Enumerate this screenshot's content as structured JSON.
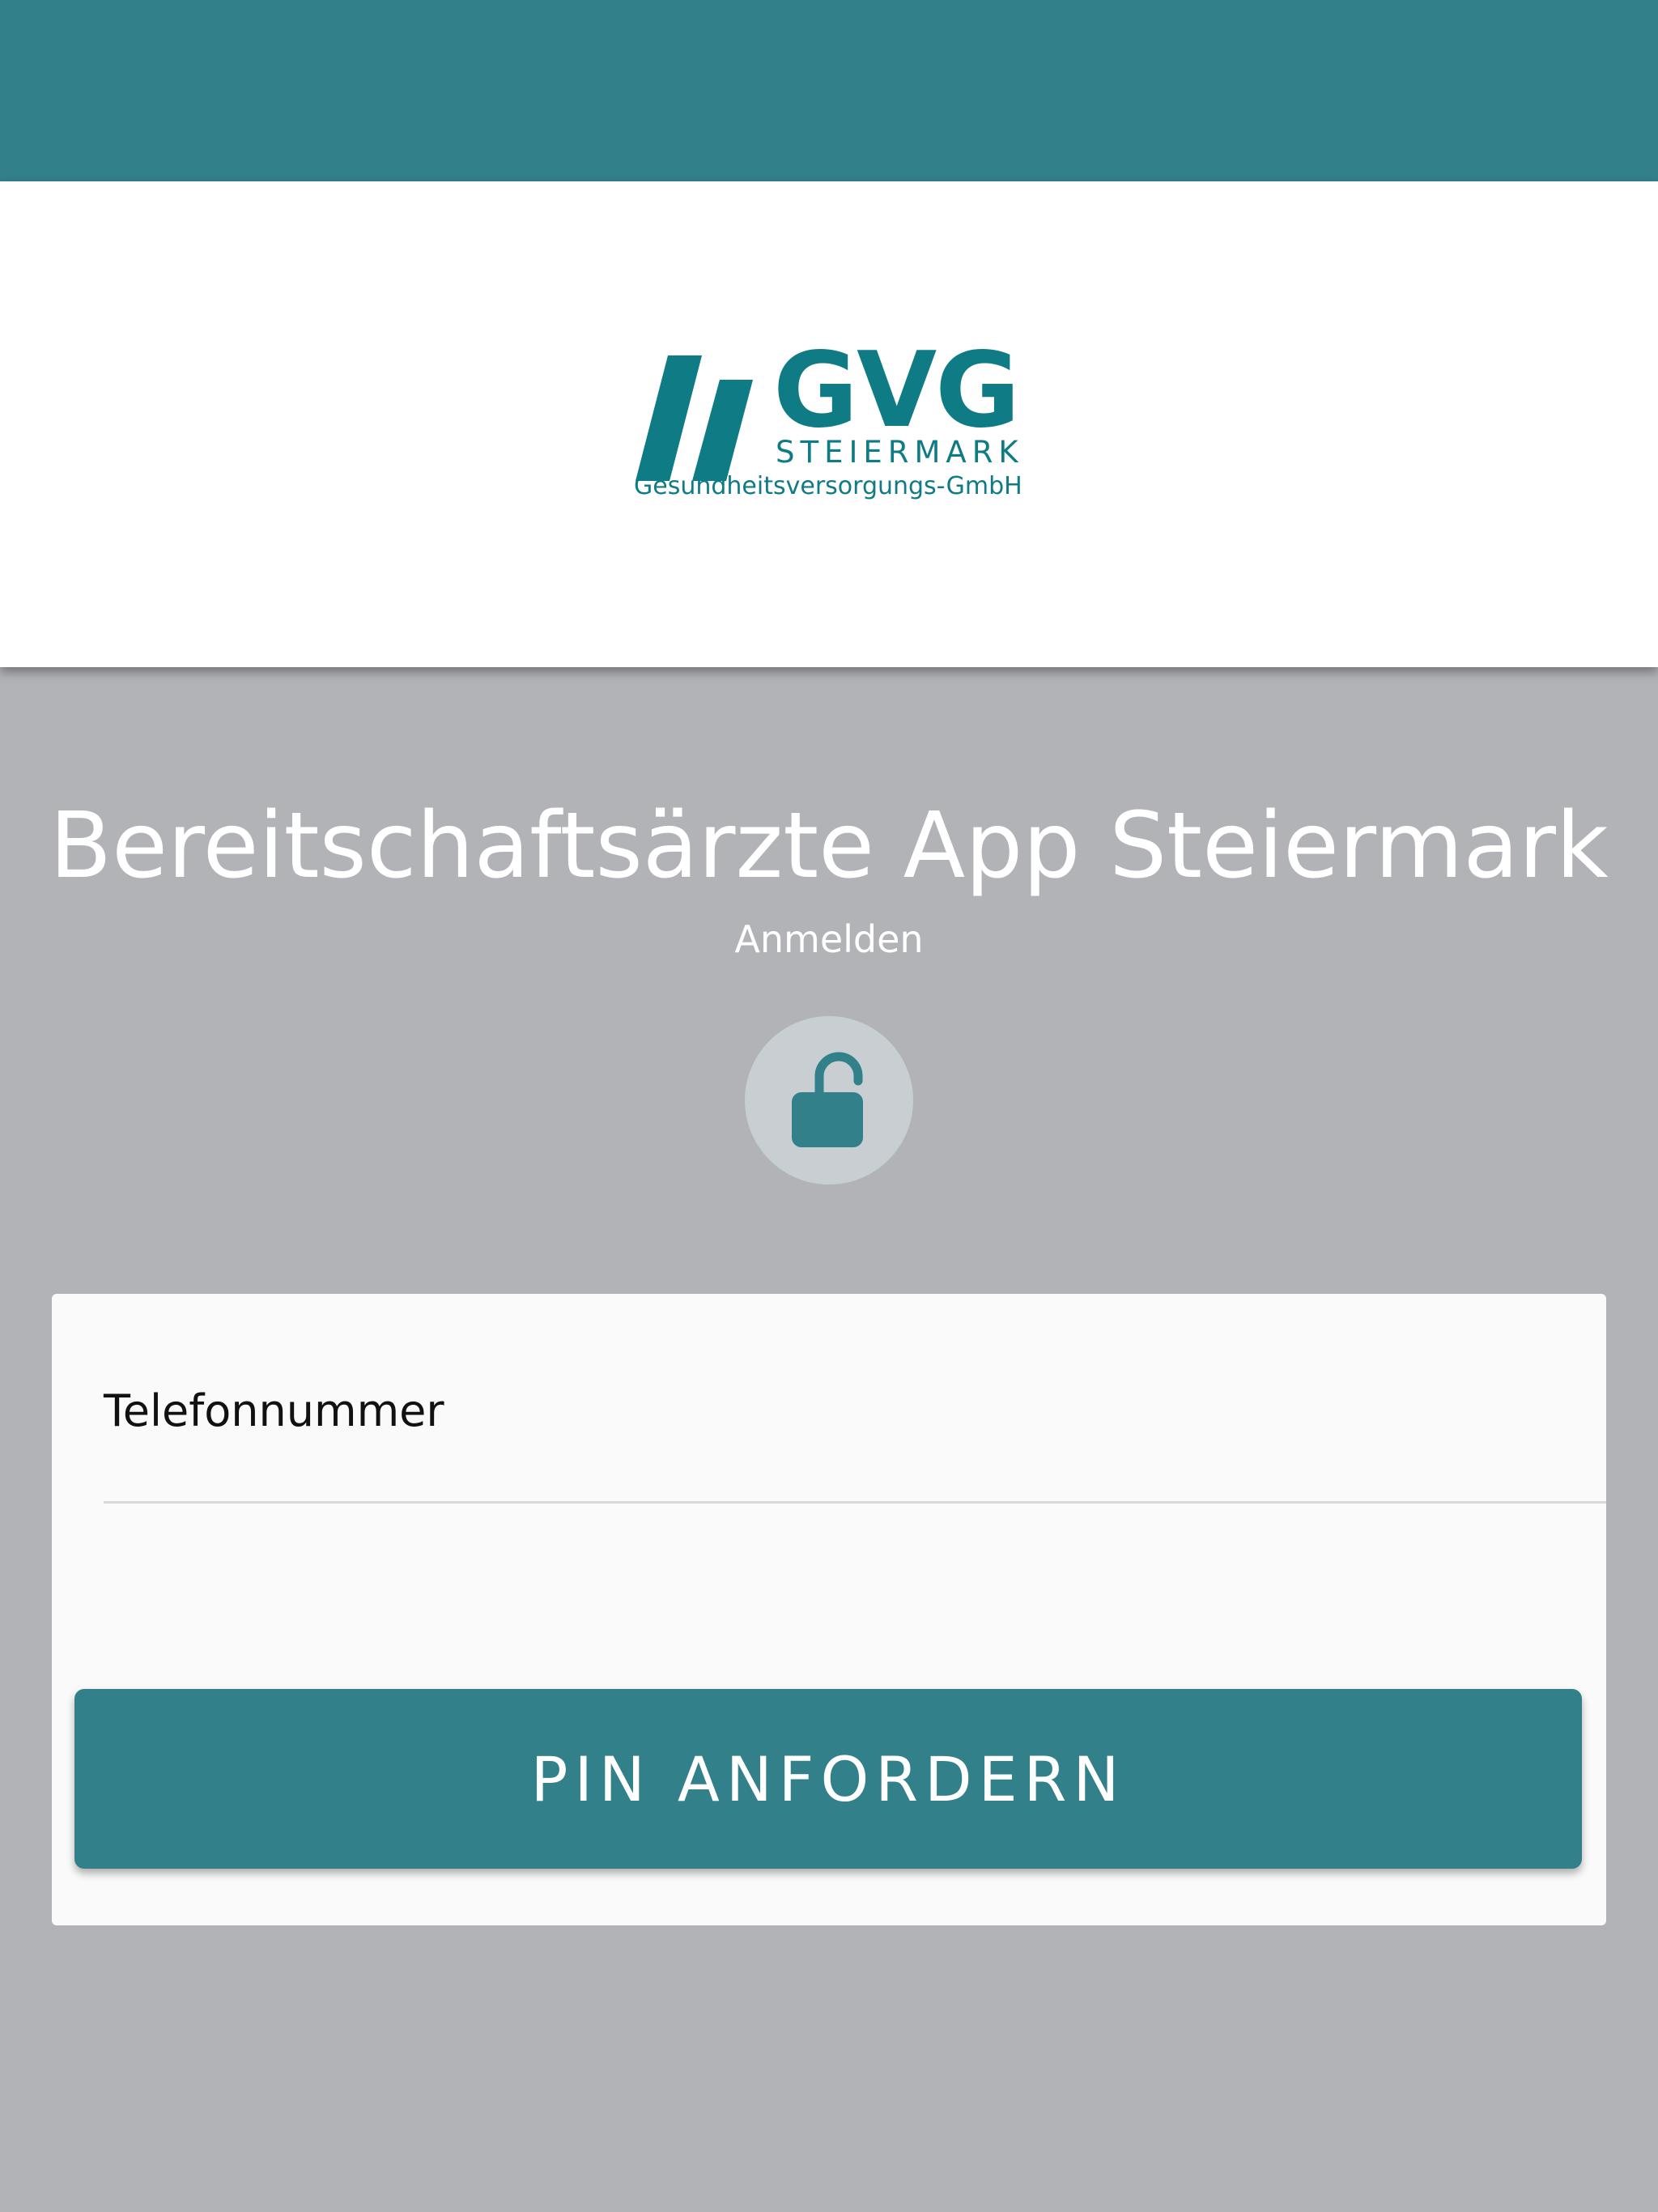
{
  "colors": {
    "accent": "#32808a",
    "brand": "#0e7b85",
    "background": "#b2b3b7",
    "card": "#fafafa",
    "lock_circle": "#c8ced1"
  },
  "logo": {
    "name": "GVG",
    "region": "STEIERMARK",
    "subtitle": "Gesundheitsversorgungs-GmbH"
  },
  "main": {
    "title": "Bereitschaftsärzte App Steiermark",
    "subtitle": "Anmelden",
    "lock_icon": "unlock-icon"
  },
  "form": {
    "phone_label": "Telefonnummer",
    "phone_value": "",
    "submit_label": "PIN ANFORDERN"
  }
}
